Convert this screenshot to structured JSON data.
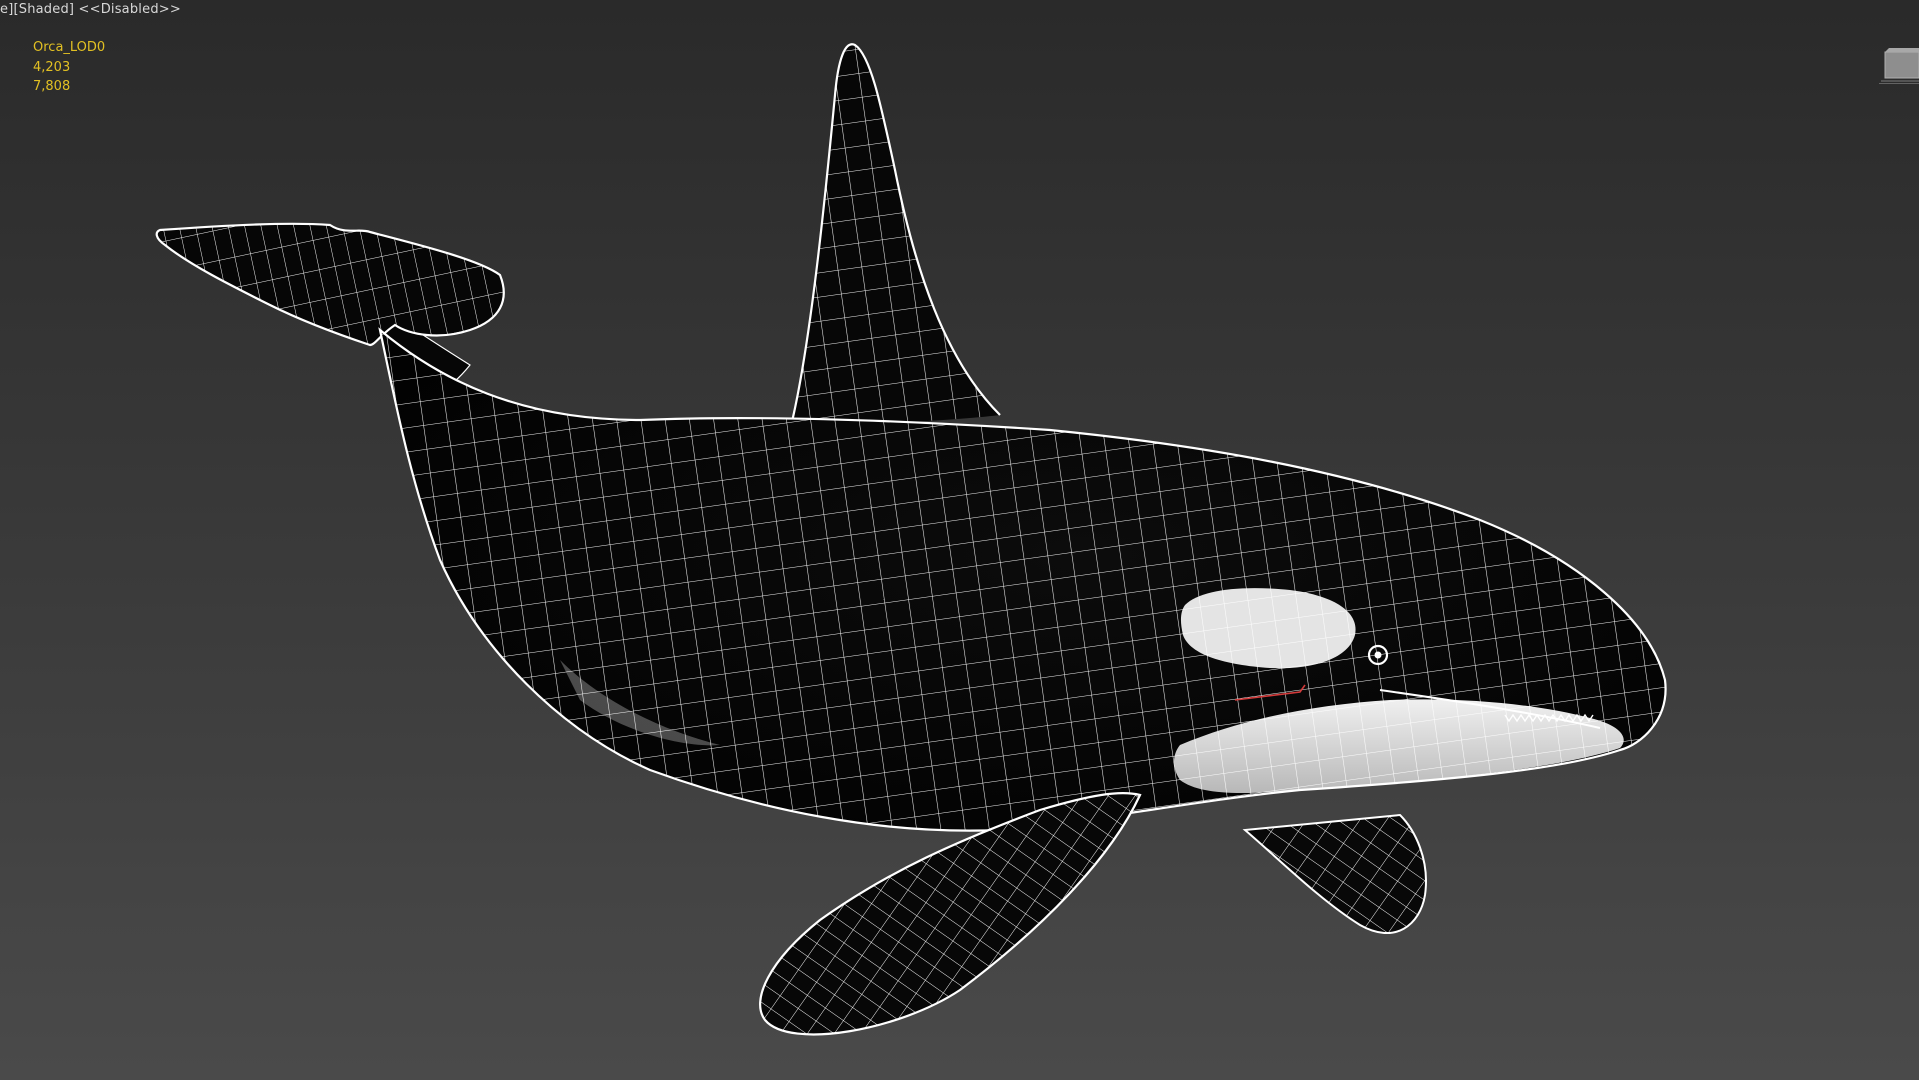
{
  "viewport": {
    "label": "e][Shaded] <<Disabled>>",
    "background_top": "#2a2a2a",
    "background_bottom": "#4a4a4a"
  },
  "stats": {
    "object_name": "Orca_LOD0",
    "vertex_count": "4,203",
    "poly_count": "7,808",
    "color": "#e2c023"
  },
  "model": {
    "icon": "orca-wireframe-model",
    "wire_color": "#ffffff",
    "body_color": "#060606",
    "patch_color": "#e6e6e6"
  },
  "navigation": {
    "icon": "viewcube-icon"
  }
}
